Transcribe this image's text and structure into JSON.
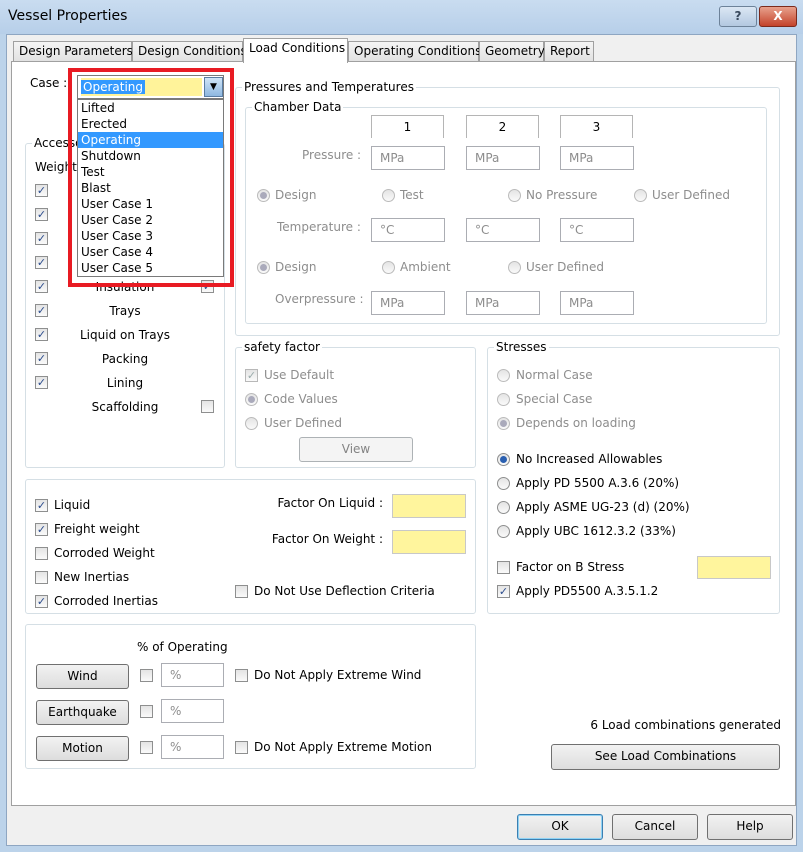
{
  "window": {
    "title": "Vessel Properties",
    "help_btn": "?",
    "close_btn": "X"
  },
  "tabs": [
    "Design Parameters",
    "Design Conditions",
    "Load Conditions",
    "Operating Conditions",
    "Geometry",
    "Report"
  ],
  "case": {
    "label": "Case :",
    "value": "Operating",
    "options": [
      "Lifted",
      "Erected",
      "Operating",
      "Shutdown",
      "Test",
      "Blast",
      "User Case 1",
      "User Case 2",
      "User Case 3",
      "User Case 4",
      "User Case 5"
    ]
  },
  "accessories": {
    "title": "Accesso",
    "weight": "Weight",
    "items": [
      {
        "label": "Insulation",
        "checked": true
      },
      {
        "label": "Trays",
        "checked": true
      },
      {
        "label": "Liquid on Trays",
        "checked": true
      },
      {
        "label": "Packing",
        "checked": true
      },
      {
        "label": "Lining",
        "checked": true
      },
      {
        "label": "Scaffolding",
        "checked": false
      }
    ]
  },
  "pt": {
    "title": "Pressures and Temperatures",
    "chamber": "Chamber Data",
    "cols": [
      "1",
      "2",
      "3"
    ],
    "pressure_label": "Pressure :",
    "pressure_unit": "MPa",
    "p_radios": [
      "Design",
      "Test",
      "No Pressure",
      "User Defined"
    ],
    "temp_label": "Temperature :",
    "temp_unit": "°C",
    "t_radios": [
      "Design",
      "Ambient",
      "User Defined"
    ],
    "over_label": "Overpressure :",
    "over_unit": "MPa"
  },
  "safety": {
    "title": "safety factor",
    "use_default": "Use Default",
    "code_values": "Code Values",
    "user_defined": "User Defined",
    "view": "View"
  },
  "stresses": {
    "title": "Stresses",
    "normal": "Normal Case",
    "special": "Special Case",
    "depends": "Depends on loading",
    "no_inc": "No Increased Allowables",
    "pd5500": "Apply PD 5500 A.3.6 (20%)",
    "asme": "Apply ASME UG-23 (d) (20%)",
    "ubc": "Apply UBC 1612.3.2 (33%)",
    "factor_b": "Factor on B Stress",
    "pd_a35": "Apply PD5500 A.3.5.1.2"
  },
  "liquid": {
    "liquid": "Liquid",
    "freight": "Freight weight",
    "corroded_weight": "Corroded Weight",
    "new_inertias": "New Inertias",
    "corroded_inertias": "Corroded Inertias",
    "factor_liquid": "Factor On Liquid :",
    "factor_weight": "Factor On Weight :",
    "no_deflection": "Do Not Use Deflection Criteria"
  },
  "env": {
    "pct_op": "% of Operating",
    "wind": "Wind",
    "earthquake": "Earthquake",
    "motion": "Motion",
    "pct": "%",
    "no_wind": "Do Not Apply Extreme Wind",
    "no_motion": "Do Not Apply Extreme Motion"
  },
  "combos": {
    "generated": "6 Load combinations generated",
    "see": "See Load Combinations"
  },
  "footer": {
    "ok": "OK",
    "cancel": "Cancel",
    "help": "Help"
  }
}
